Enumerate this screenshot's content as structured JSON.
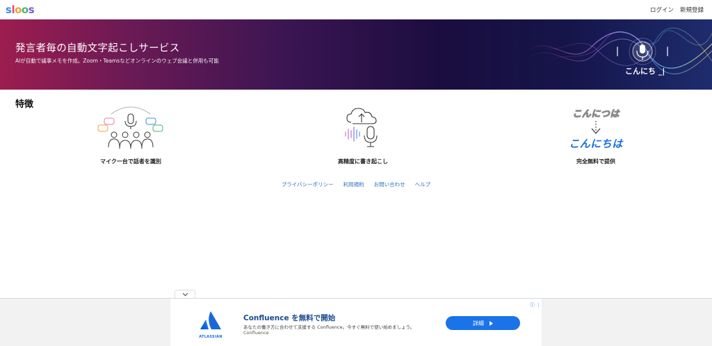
{
  "header": {
    "logo_letters": [
      {
        "ch": "s",
        "color": "#3a8ee6"
      },
      {
        "ch": "l",
        "color": "#e94b6a"
      },
      {
        "ch": "o",
        "color": "#f2a03d"
      },
      {
        "ch": "o",
        "color": "#4bb56d"
      },
      {
        "ch": "s",
        "color": "#7a5bd6"
      }
    ],
    "login_label": "ログイン",
    "signup_label": "新規登録"
  },
  "hero": {
    "title": "発言者毎の自動文字起こしサービス",
    "subtitle": "AIが自動で議事メモを作成。Zoom・Teamsなどオンラインのウェブ会議と併用も可能",
    "caption": "こんにち _|"
  },
  "features": {
    "title": "特徴",
    "items": [
      {
        "label": "マイク一台で話者を識別",
        "icon": "speakers-mic-icon"
      },
      {
        "label": "高精度に書き起こし",
        "icon": "cloud-mic-icon"
      },
      {
        "label": "完全無料で提供",
        "old_text": "こんにつは",
        "new_text": "こんにちは"
      }
    ]
  },
  "footer": {
    "links": [
      "プライバシーポリシー",
      "利用規約",
      "お問い合わせ",
      "ヘルプ"
    ]
  },
  "ad": {
    "toggle_icon": "chevron-down-icon",
    "logo_text": "ATLASSIAN",
    "headline": "Confluence を無料で開始",
    "body": "あなたの働き方に合わせて支援する Confluence。今すぐ無料で使い始めましょう。",
    "brand": "Confluence",
    "button_label": "詳細",
    "brand_color": "#1a73e8"
  }
}
